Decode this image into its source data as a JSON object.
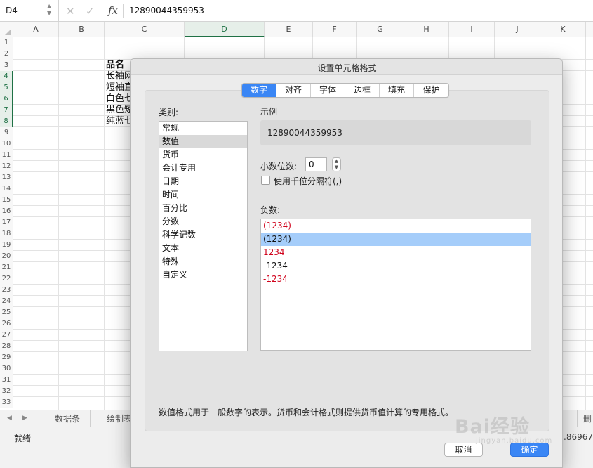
{
  "formula_bar": {
    "name_box": "D4",
    "cancel_icon": "close-icon",
    "confirm_icon": "check-icon",
    "fx_label": "fx",
    "formula": "12890044359953"
  },
  "columns": [
    "A",
    "B",
    "C",
    "D",
    "E",
    "F",
    "G",
    "H",
    "I",
    "J",
    "K"
  ],
  "active_column": "D",
  "rows": [
    "1",
    "2",
    "3",
    "4",
    "5",
    "6",
    "7",
    "8",
    "9",
    "10",
    "11",
    "12",
    "13",
    "14",
    "15",
    "16",
    "17",
    "18",
    "19",
    "20",
    "21",
    "22",
    "23",
    "24",
    "25",
    "26",
    "27",
    "28",
    "29",
    "30",
    "31",
    "32",
    "33"
  ],
  "cells": {
    "c3": "品名",
    "c4": "长袖网",
    "c5": "短袖直",
    "c6": "白色七",
    "c7": "黑色短",
    "c8": "纯蓝七"
  },
  "sheet_tabs": [
    "数据条",
    "绘制表"
  ],
  "sheet_tab_right": "删",
  "status": {
    "left": "就绪",
    "right": "1.86967"
  },
  "dialog": {
    "title": "设置单元格格式",
    "tabs": [
      "数字",
      "对齐",
      "字体",
      "边框",
      "填充",
      "保护"
    ],
    "selected_tab": "数字",
    "category_label": "类别:",
    "categories": [
      "常规",
      "数值",
      "货币",
      "会计专用",
      "日期",
      "时间",
      "百分比",
      "分数",
      "科学记数",
      "文本",
      "特殊",
      "自定义"
    ],
    "selected_category": "数值",
    "sample_label": "示例",
    "sample_value": "12890044359953",
    "decimal_label": "小数位数:",
    "decimal_value": "0",
    "thousands_label": "使用千位分隔符(,)",
    "thousands_checked": false,
    "negative_label": "负数:",
    "negative_options": [
      {
        "text": "(1234)",
        "color": "#d0021b"
      },
      {
        "text": "(1234)",
        "color": "#111111"
      },
      {
        "text": "1234",
        "color": "#d0021b"
      },
      {
        "text": "-1234",
        "color": "#111111"
      },
      {
        "text": "-1234",
        "color": "#d0021b"
      }
    ],
    "selected_negative_index": 1,
    "description": "数值格式用于一般数字的表示。货币和会计格式则提供货币值计算的专用格式。",
    "cancel_label": "取消",
    "ok_label": "确定"
  },
  "watermark": {
    "logo_text": "Bai经验",
    "sub_text": "jingyan.baidu.com"
  },
  "colors": {
    "accent": "#3a86f5",
    "excel_green": "#1f7145",
    "selection_blue": "#a5cdfa"
  }
}
